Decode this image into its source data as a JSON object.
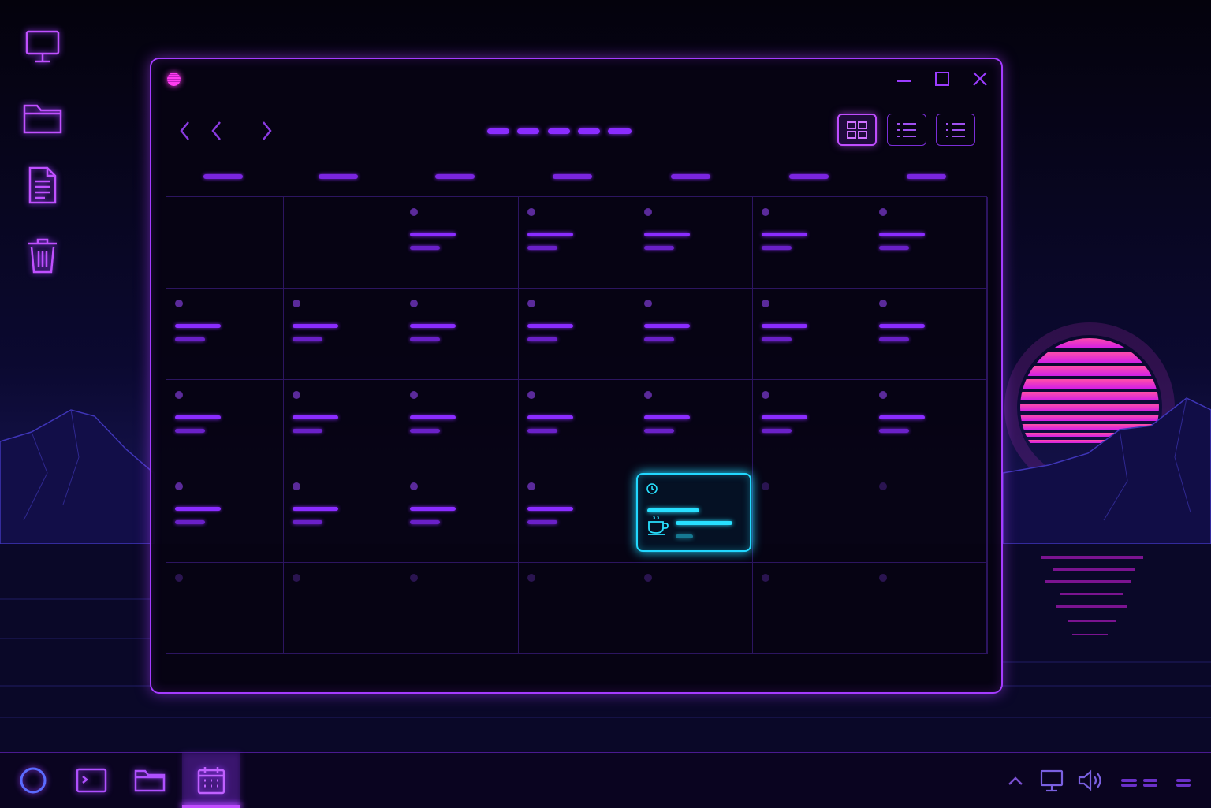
{
  "desktop": {
    "icons": [
      "monitor-icon",
      "folder-icon",
      "document-icon",
      "trash-icon"
    ]
  },
  "calendar_window": {
    "view": "month",
    "view_buttons": [
      "grid-view-icon",
      "list-view-icon",
      "list-view-icon"
    ],
    "active_view_index": 0,
    "rows": 5,
    "columns": 7,
    "selected_cell": {
      "row": 3,
      "column": 4
    },
    "event_icons": [
      "clock-icon",
      "coffee-cup-icon"
    ]
  },
  "taskbar": {
    "items": [
      "start-ring-icon",
      "terminal-icon",
      "folder-icon",
      "calendar-icon"
    ],
    "active_item_index": 3,
    "tray": [
      "chevron-up-icon",
      "display-icon",
      "speaker-icon"
    ]
  },
  "colors": {
    "accent_purple": "#a53cff",
    "accent_magenta": "#ff3df0",
    "accent_cyan": "#22d8ff",
    "background": "#05020f"
  }
}
